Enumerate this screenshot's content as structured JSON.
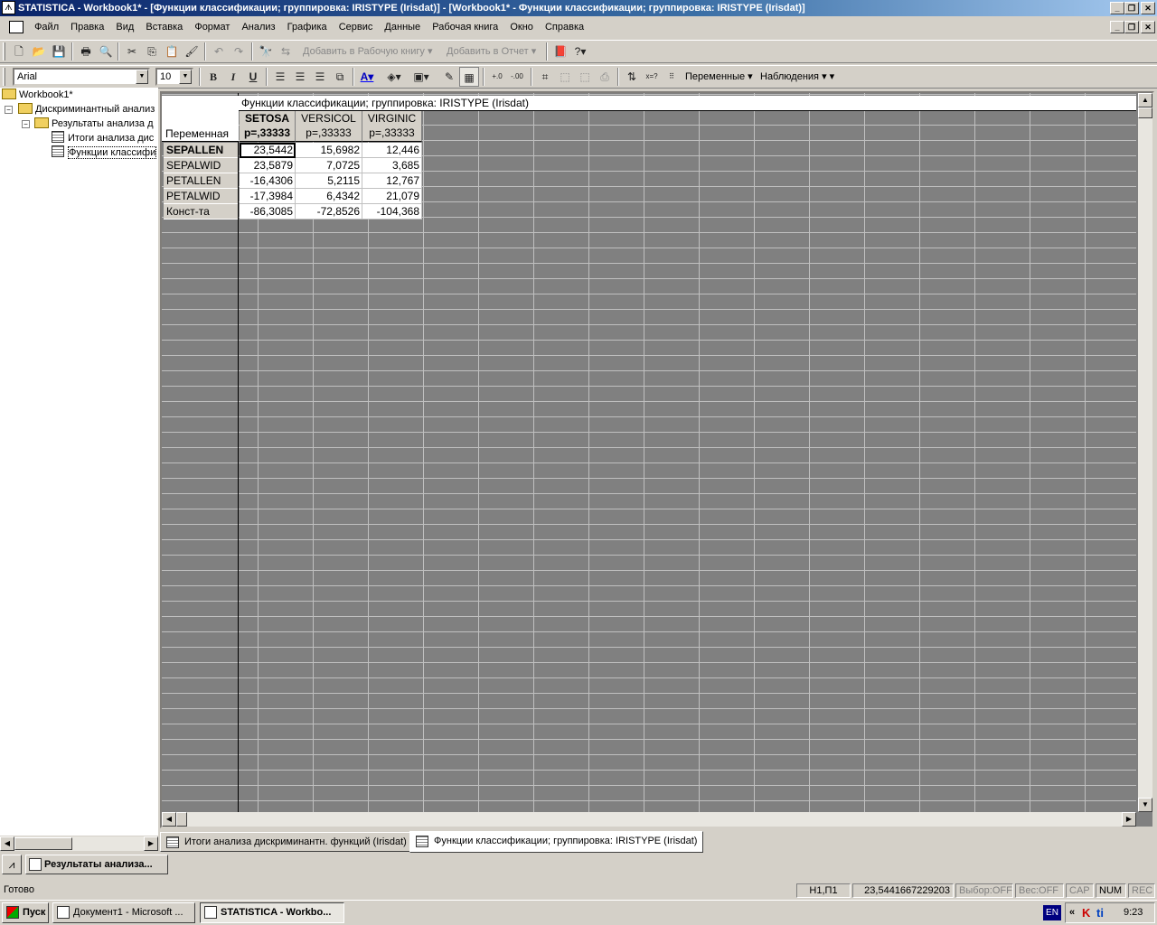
{
  "window": {
    "title": "STATISTICA - Workbook1* - [Функции классификации; группировка: IRISTYPE (Irisdat)] - [Workbook1* - Функции классификации; группировка: IRISTYPE (Irisdat)]"
  },
  "menu": [
    "Файл",
    "Правка",
    "Вид",
    "Вставка",
    "Формат",
    "Анализ",
    "Графика",
    "Сервис",
    "Данные",
    "Рабочая книга",
    "Окно",
    "Справка"
  ],
  "toolbar": {
    "add_to_workbook": "Добавить в Рабочую книгу",
    "add_to_report": "Добавить в Отчет"
  },
  "format_toolbar": {
    "font": "Arial",
    "size": "10",
    "bold": "B",
    "italic": "I",
    "underline": "U",
    "variables": "Переменные",
    "cases": "Наблюдения",
    "x_question": "x=?"
  },
  "tree": {
    "root": "Workbook1*",
    "analysis": "Дискриминантный анализ",
    "results": "Результаты анализа д",
    "item1": "Итоги анализа дис",
    "item2": "Функции классифи"
  },
  "table": {
    "title": "Функции классификации; группировка: IRISTYPE (Irisdat)",
    "row_header_label": "Переменная",
    "columns": [
      {
        "name": "SETOSA",
        "p": "p=,33333"
      },
      {
        "name": "VERSICOL",
        "p": "p=,33333"
      },
      {
        "name": "VIRGINIC",
        "p": "p=,33333"
      }
    ],
    "rows": [
      {
        "label": "SEPALLEN",
        "values": [
          "23,5442",
          "15,6982",
          "12,446"
        ]
      },
      {
        "label": "SEPALWID",
        "values": [
          "23,5879",
          "7,0725",
          "3,685"
        ]
      },
      {
        "label": "PETALLEN",
        "values": [
          "-16,4306",
          "5,2115",
          "12,767"
        ]
      },
      {
        "label": "PETALWID",
        "values": [
          "-17,3984",
          "6,4342",
          "21,079"
        ]
      },
      {
        "label": "Конст-та",
        "values": [
          "-86,3085",
          "-72,8526",
          "-104,368"
        ]
      }
    ]
  },
  "tabs": [
    "Итоги анализа дискриминантн. функций (Irisdat)",
    "Функции классификации; группировка: IRISTYPE (Irisdat)"
  ],
  "minimized": "Результаты анализа...",
  "status": {
    "ready": "Готово",
    "cell": "H1,П1",
    "value": "23,5441667229203",
    "selection": "Выбор:OFF",
    "weight": "Вес:OFF",
    "cap": "CAP",
    "num": "NUM",
    "rec": "REC"
  },
  "taskbar": {
    "start": "Пуск",
    "task1": "Документ1 - Microsoft ...",
    "task2": "STATISTICA - Workbo...",
    "lang": "EN",
    "clock": "9:23"
  }
}
